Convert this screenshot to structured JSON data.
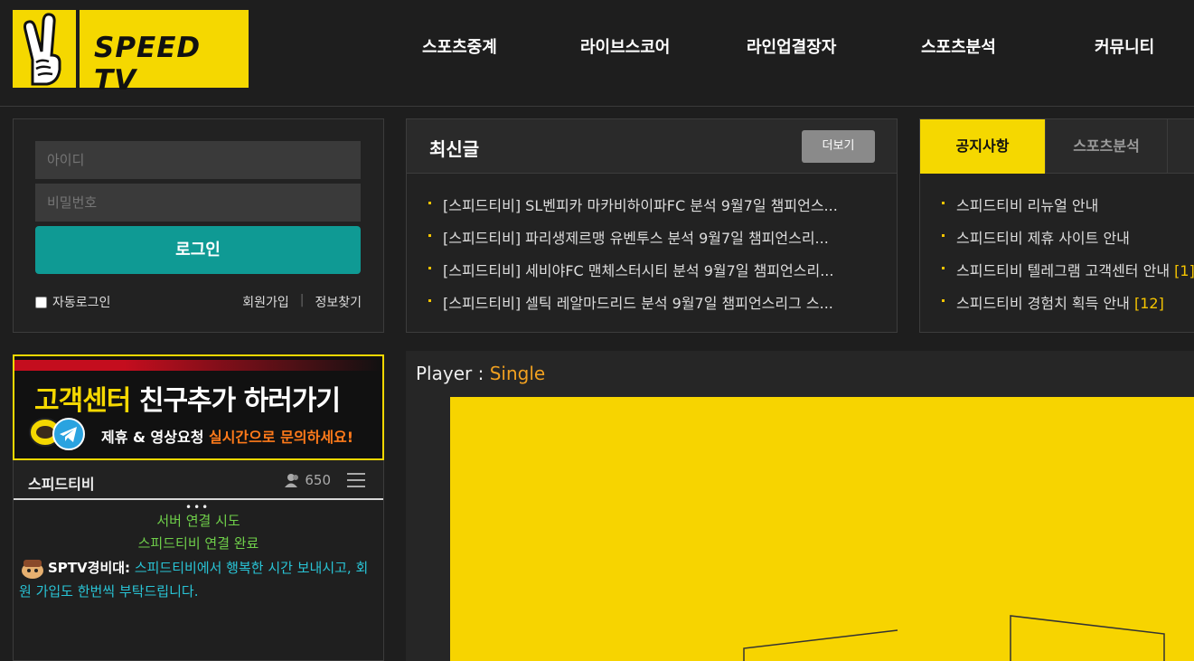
{
  "brand": {
    "name": "SPEED TV",
    "accent": "#f5d800",
    "teal": "#0f9a94"
  },
  "nav": [
    "스포츠중계",
    "라이브스코어",
    "라인업결장자",
    "스포츠분석",
    "커뮤니티"
  ],
  "login": {
    "id_placeholder": "아이디",
    "pw_placeholder": "비밀번호",
    "submit_label": "로그인",
    "auto_login_label": "자동로그인",
    "join_label": "회원가입",
    "find_label": "정보찾기"
  },
  "latest": {
    "title": "최신글",
    "more_label": "더보기",
    "posts": [
      "[스피드티비] SL벤피카 마카비하이파FC 분석 9월7일 챔피언스...",
      "[스피드티비] 파리생제르맹 유벤투스 분석 9월7일 챔피언스리...",
      "[스피드티비] 세비야FC 맨체스터시티 분석 9월7일 챔피언스리...",
      "[스피드티비] 셀틱 레알마드리드 분석 9월7일 챔피언스리그 스..."
    ]
  },
  "notice": {
    "tab_active": "공지사항",
    "tab_other": "스포츠분석",
    "items": [
      {
        "text": "스피드티비 리뉴얼 안내",
        "count": ""
      },
      {
        "text": "스피드티비 제휴 사이트 안내",
        "count": ""
      },
      {
        "text": "스피드티비 텔레그램 고객센터 안내",
        "count": "[1]"
      },
      {
        "text": "스피드티비 경험치 획득 안내",
        "count": "[12]"
      }
    ]
  },
  "banner": {
    "title_hl": "고객센터",
    "title_rest": " 친구추가 하러가기",
    "sub_plain": "제휴 & 영상요청 ",
    "sub_hl": "실시간으로 문의하세요!"
  },
  "chat": {
    "room_name": "스피드티비",
    "user_count": "650",
    "dots": "•••",
    "sys1": "서버 연결 시도",
    "sys2": "스피드티비 연결 완료",
    "msg_user": "SPTV경비대:",
    "msg_text": " 스피드티비에서 행복한 시간 보내시고, 회원 가입도 한번씩 부탁드립니다."
  },
  "player": {
    "label": "Player : ",
    "mode": "Single"
  }
}
